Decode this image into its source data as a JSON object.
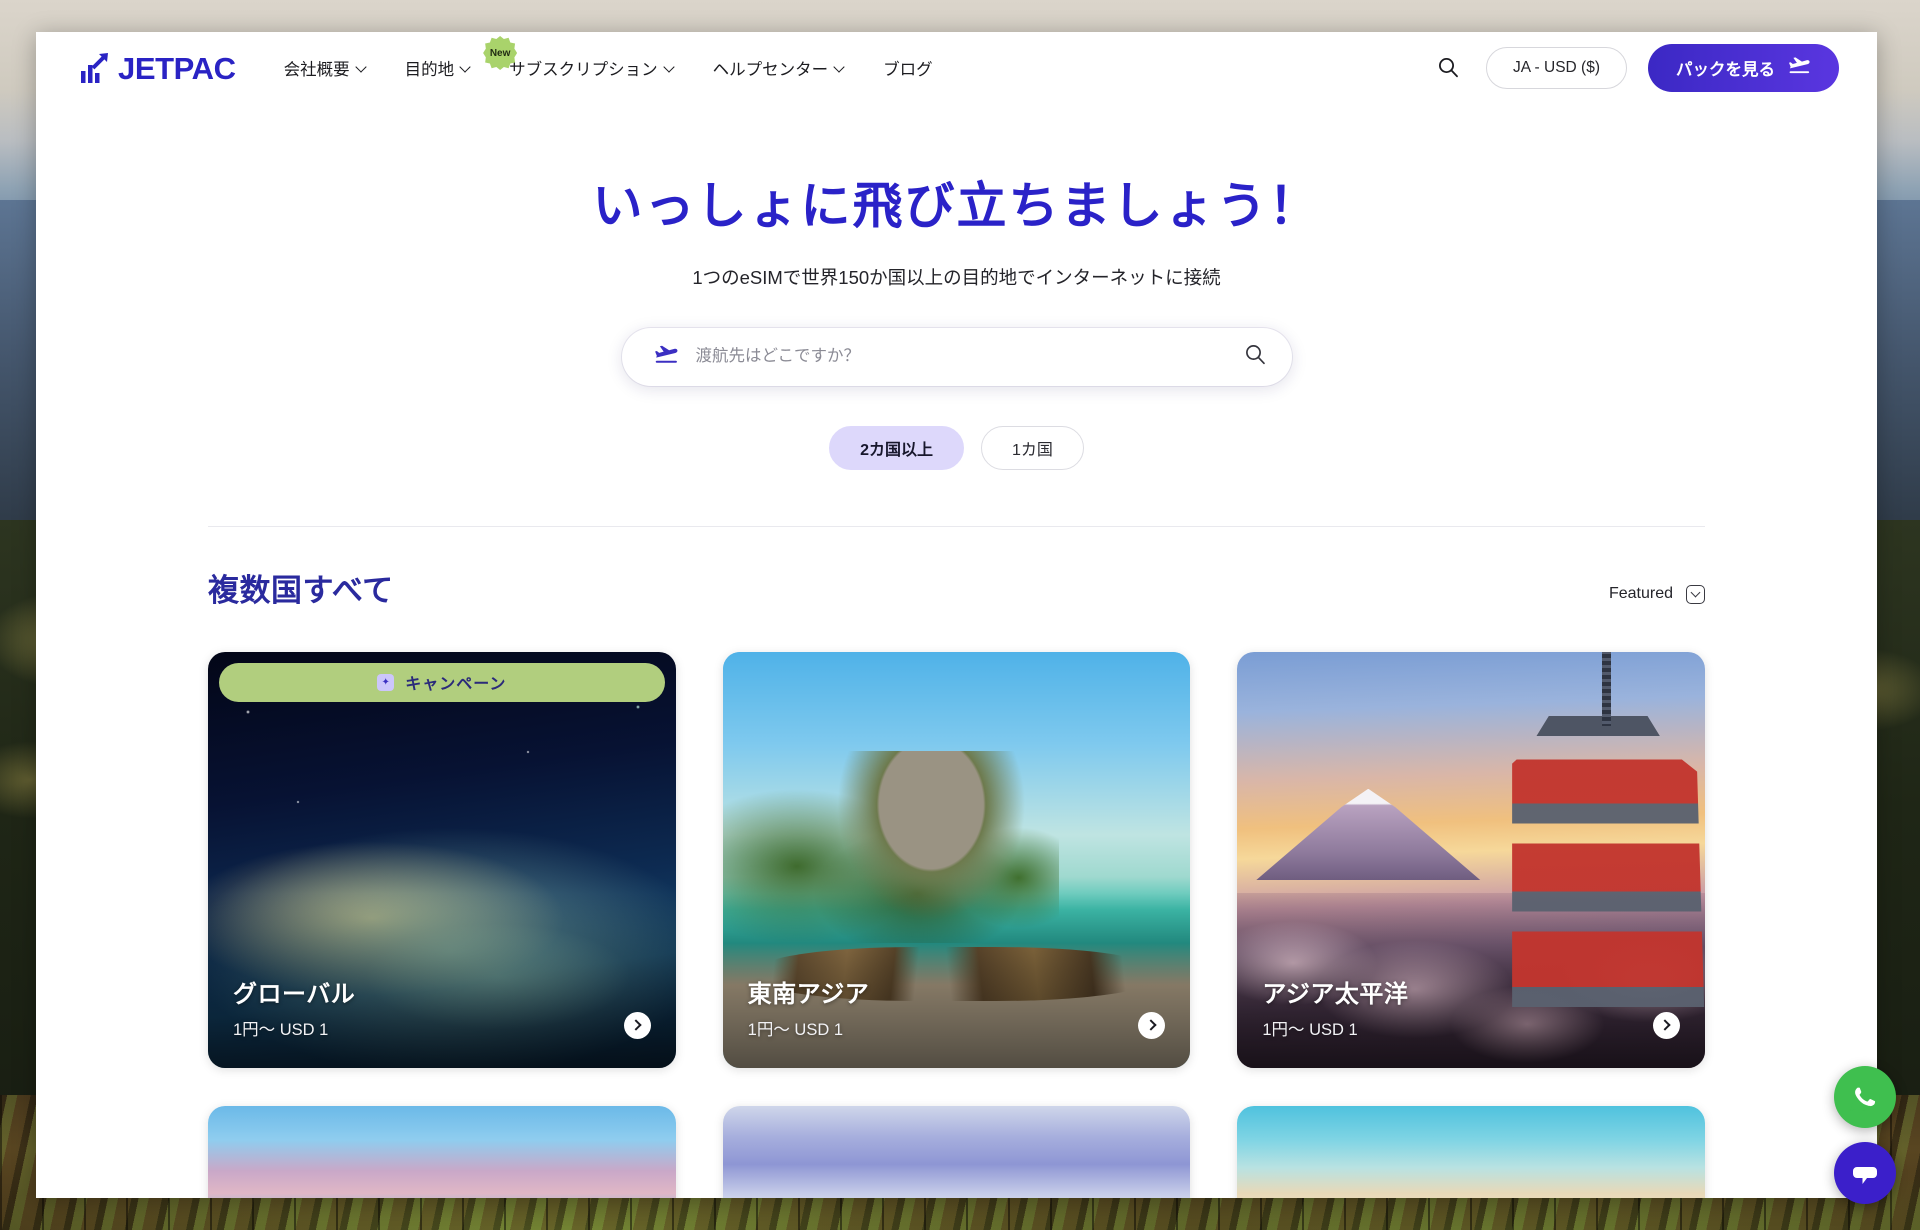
{
  "brand": {
    "name": "JETPAC",
    "logo_icon": "bar-chart-arrow-icon",
    "color": "#2a23c4"
  },
  "nav": {
    "items": [
      {
        "label": "会社概要",
        "has_chevron": true,
        "badge": null
      },
      {
        "label": "目的地",
        "has_chevron": true,
        "badge": null
      },
      {
        "label": "サブスクリプション",
        "has_chevron": true,
        "badge": "New"
      },
      {
        "label": "ヘルプセンター",
        "has_chevron": true,
        "badge": null
      },
      {
        "label": "ブログ",
        "has_chevron": false,
        "badge": null
      }
    ]
  },
  "header_right": {
    "search_icon": "search-icon",
    "currency_label": "JA - USD ($)",
    "cta_label": "パックを見る",
    "cta_icon": "plane-landing-icon"
  },
  "hero": {
    "title": "いっしょに飛び立ちましょう！",
    "subtitle": "1つのeSIMで世界150か国以上の目的地でインターネットに接続"
  },
  "search": {
    "leading_icon": "plane-landing-icon",
    "placeholder": "渡航先はどこですか？",
    "value": "",
    "trailing_icon": "search-icon"
  },
  "filters": {
    "pills": [
      {
        "label": "2カ国以上",
        "active": true
      },
      {
        "label": "1カ国",
        "active": false
      }
    ]
  },
  "section": {
    "title": "複数国すべて",
    "sort_label": "Featured",
    "sort_icon": "chevron-down-boxed-icon"
  },
  "cards": [
    {
      "title": "グローバル",
      "price": "1円〜 USD 1",
      "promo": "キャンペーン",
      "promo_icon": "tag-icon",
      "go_icon": "arrow-right-circle-icon"
    },
    {
      "title": "東南アジア",
      "price": "1円〜 USD 1",
      "promo": null,
      "go_icon": "arrow-right-circle-icon"
    },
    {
      "title": "アジア太平洋",
      "price": "1円〜 USD 1",
      "promo": null,
      "go_icon": "arrow-right-circle-icon"
    }
  ],
  "floating": {
    "whatsapp": {
      "icon": "whatsapp-icon",
      "color": "#3fbf4f"
    },
    "chat": {
      "icon": "chat-bubble-icon",
      "color": "#3b1fca"
    }
  },
  "colors": {
    "brand_purple": "#2a23c4",
    "cta_gradient_start": "#3b28c4",
    "cta_gradient_end": "#5a36e0",
    "pill_active_bg": "#ddd8fb",
    "promo_green": "#b1ce7e",
    "heading_indigo": "#2a2a9e"
  }
}
